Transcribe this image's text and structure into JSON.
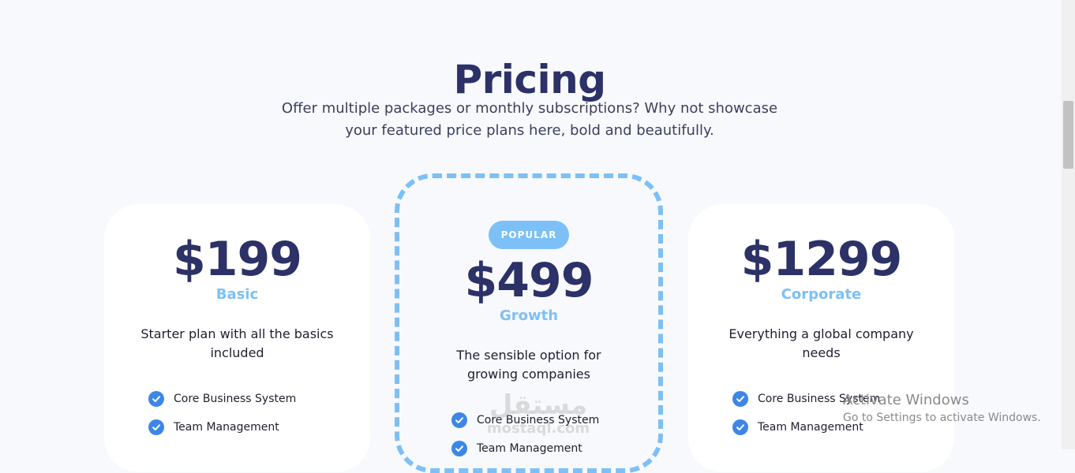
{
  "header": {
    "title": "Pricing",
    "subtitle_line1": "Offer multiple packages or monthly subscriptions? Why not showcase",
    "subtitle_line2": "your featured price plans here, bold and beautifully."
  },
  "plans": [
    {
      "price": "$199",
      "name": "Basic",
      "desc_line1": "Starter plan with all the basics",
      "desc_line2": "included",
      "features": [
        "Core Business System",
        "Team Management"
      ]
    },
    {
      "badge": "POPULAR",
      "price": "$499",
      "name": "Growth",
      "desc_line1": "The sensible option for",
      "desc_line2": "growing companies",
      "features": [
        "Core Business System",
        "Team Management"
      ]
    },
    {
      "price": "$1299",
      "name": "Corporate",
      "desc_line1": "Everything a global company",
      "desc_line2": "needs",
      "features": [
        "Core Business System",
        "Team Management"
      ]
    }
  ],
  "overlay": {
    "activate_title": "Activate Windows",
    "activate_sub": "Go to Settings to activate Windows.",
    "watermark_ar": "مستقل",
    "watermark_en": "mostaql.com"
  },
  "colors": {
    "title": "#2c3167",
    "accent": "#7cc0f7",
    "check": "#3d86e6",
    "background": "#f8f9fc"
  },
  "icons": {
    "feature_icon": "check-circle-icon"
  }
}
